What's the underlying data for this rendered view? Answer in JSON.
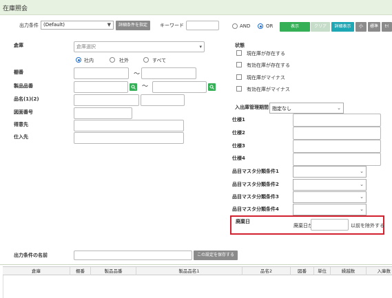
{
  "window": {
    "title": "在庫照会"
  },
  "toolbar": {
    "output_condition_label": "出力条件",
    "output_condition_value": "(Default)",
    "detail_condition_btn": "詳細条件を指定",
    "keyword_label": "キーワード",
    "keyword_value": "",
    "and_label": "AND",
    "or_label": "OR",
    "logic_selected": "OR",
    "display_btn": "表示",
    "clear_btn": "クリア",
    "detail_display_btn": "詳細表示",
    "small_btn": "小",
    "standard_btn": "標準",
    "last_btn": "ｾｲ"
  },
  "form": {
    "warehouse_label": "倉庫",
    "warehouse_placeholder": "倉庫選択",
    "scope_options": [
      "社内",
      "社外",
      "すべて"
    ],
    "scope_selected": "社内",
    "shelf_label": "棚番",
    "range_sep": "～",
    "product_code_label": "製品品番",
    "product_name_label": "品名(1)(2)",
    "drawing_no_label": "図面番号",
    "ordering_party_label": "得意先",
    "supplier_label": "仕入先"
  },
  "status": {
    "label": "状態",
    "options": [
      {
        "label": "現在庫が存在する",
        "checked": false
      },
      {
        "label": "有効在庫が存在する",
        "checked": false
      },
      {
        "label": "現在庫がマイナス",
        "checked": false
      },
      {
        "label": "有効在庫がマイナス",
        "checked": false
      }
    ]
  },
  "io_period": {
    "label": "入出庫管理期間",
    "value": "指定なし"
  },
  "specs": [
    {
      "label": "仕様1",
      "value": ""
    },
    {
      "label": "仕様2",
      "value": ""
    },
    {
      "label": "仕様3",
      "value": ""
    },
    {
      "label": "仕様4",
      "value": ""
    }
  ],
  "master_conditions": [
    {
      "label": "品目マスタ分類条件1",
      "value": ""
    },
    {
      "label": "品目マスタ分類条件2",
      "value": ""
    },
    {
      "label": "品目マスタ分類条件3",
      "value": ""
    },
    {
      "label": "品目マスタ分類条件4",
      "value": ""
    }
  ],
  "obsolete": {
    "label": "廃棄日",
    "prefix": "廃棄日が",
    "value": "",
    "suffix": "以前を除外する"
  },
  "save_condition": {
    "label": "出力条件の名前",
    "value": "",
    "button": "この設定を保存する"
  },
  "table": {
    "columns": [
      "倉庫",
      "棚番",
      "製品品番",
      "製品品名1",
      "品名2",
      "図番",
      "単位",
      "繰越数",
      "入庫数"
    ]
  }
}
